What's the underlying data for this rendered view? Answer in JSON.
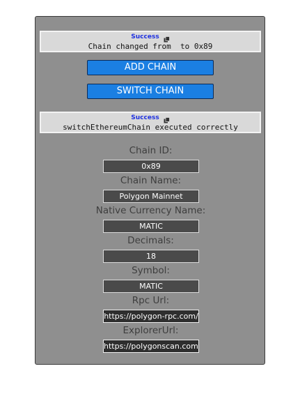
{
  "toasts": [
    {
      "title": "Success",
      "icon": "copy-icon",
      "message": "Chain changed from  to 0x89"
    },
    {
      "title": "Success",
      "icon": "copy-icon",
      "message": "switchEthereumChain executed correctly"
    }
  ],
  "buttons": {
    "add_chain": "ADD CHAIN",
    "switch_chain": "SWITCH CHAIN"
  },
  "fields": [
    {
      "label": "Chain ID:",
      "value": "0x89"
    },
    {
      "label": "Chain Name:",
      "value": "Polygon Mainnet"
    },
    {
      "label": "Native Currency Name:",
      "value": "MATIC"
    },
    {
      "label": "Decimals:",
      "value": "18"
    },
    {
      "label": "Symbol:",
      "value": "MATIC"
    },
    {
      "label": "Rpc Url:",
      "value": "https://polygon-rpc.com/"
    },
    {
      "label": "ExplorerUrl:",
      "value": "https://polygonscan.com/"
    }
  ],
  "colors": {
    "panel_bg": "#8f8f8f",
    "button_bg": "#1b7fe2",
    "toast_title": "#1f31e0"
  }
}
